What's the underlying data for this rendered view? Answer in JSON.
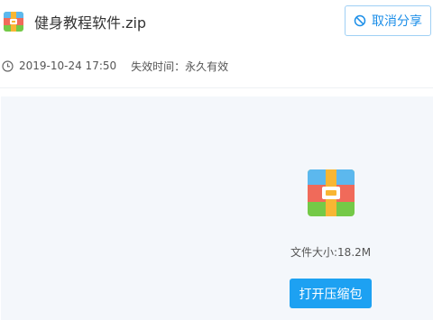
{
  "file": {
    "name": "健身教程软件.zip",
    "icon": "zip-archive-icon",
    "size_label": "文件大小:18.2M"
  },
  "share": {
    "created_time": "2019-10-24 17:50",
    "expire_text": "失效时间：永久有效",
    "cancel_label": "取消分享"
  },
  "actions": {
    "open_label": "打开压缩包"
  },
  "colors": {
    "accent": "#1da1f2",
    "panel_bg": "#f4f7fb",
    "zip_blue": "#5cb8ee",
    "zip_red": "#f06a5a",
    "zip_green": "#74c947",
    "zip_yellow": "#f8b633"
  }
}
